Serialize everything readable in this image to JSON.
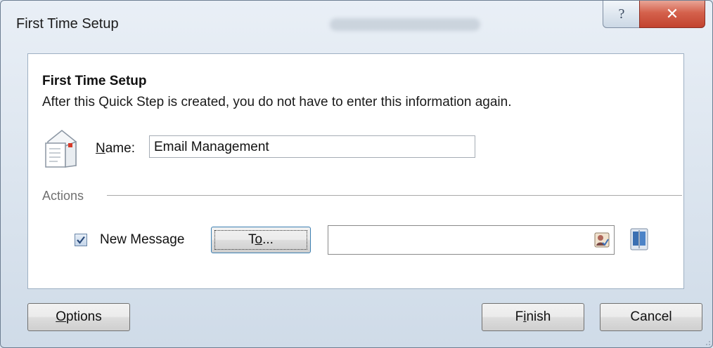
{
  "window": {
    "title": "First Time Setup",
    "help_glyph": "?",
    "close_glyph": "✕"
  },
  "content": {
    "heading": "First Time Setup",
    "description": "After this Quick Step is created, you do not have to enter this information again.",
    "name_label_accesskey": "N",
    "name_label_rest": "ame:",
    "name_value": "Email Management",
    "actions_label": "Actions",
    "action": {
      "checked": true,
      "label": "New Message",
      "to_button_accesskey_prefix": "T",
      "to_button_accesskey": "o",
      "to_button_suffix": "...",
      "to_value": ""
    }
  },
  "footer": {
    "options_accesskey": "O",
    "options_rest": "ptions",
    "finish_prefix": "F",
    "finish_accesskey": "i",
    "finish_rest": "nish",
    "cancel_label": "Cancel"
  },
  "icons": {
    "message": "new-message-envelope-icon",
    "contact": "contact-check-icon",
    "address_book": "address-book-icon"
  }
}
